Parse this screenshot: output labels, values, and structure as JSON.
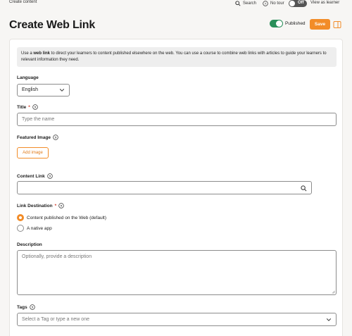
{
  "topbar": {
    "breadcrumb": "Create content",
    "search_label": "Search",
    "tour_label": "No tour",
    "learner_toggle": "Off",
    "view_as_learner": "View as learner"
  },
  "header": {
    "title": "Create Web Link",
    "published_label": "Published",
    "save_label": "Save"
  },
  "info": {
    "prefix": "Use a ",
    "bold": "web link",
    "suffix": " to direct your learners to content published elsewhere on the web. You can use a course to combine web links with articles to guide your learners to relevant information they need."
  },
  "form": {
    "language": {
      "label": "Language",
      "value": "English"
    },
    "title": {
      "label": "Title",
      "required_mark": "*",
      "placeholder": "Type the name"
    },
    "featured_image": {
      "label": "Featured Image",
      "button": "Add image"
    },
    "content_link": {
      "label": "Content Link"
    },
    "link_destination": {
      "label": "Link Destination",
      "required_mark": "*",
      "options": [
        "Content published on the Web (default)",
        "A native app"
      ],
      "selected": 0
    },
    "description": {
      "label": "Description",
      "placeholder": "Optionally, provide a description"
    },
    "tags": {
      "label": "Tags",
      "placeholder": "Select a Tag or type a new one"
    }
  },
  "colors": {
    "accent": "#f28c28",
    "published_green": "#2a8f5a",
    "required_red": "#d23c2a"
  }
}
